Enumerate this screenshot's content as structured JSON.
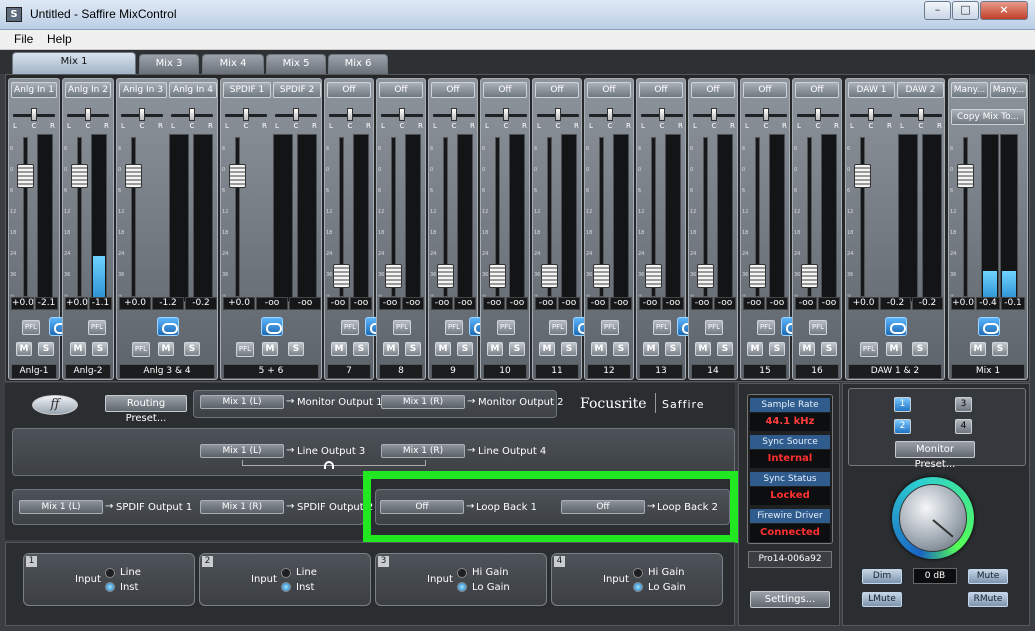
{
  "window": {
    "title": "Untitled - Saffire MixControl",
    "app_icon": "S",
    "minimize_icon": "minimize-icon",
    "maximize_icon": "maximize-icon",
    "close_icon": "close-icon"
  },
  "menu": {
    "file": "File",
    "help": "Help"
  },
  "tabs": [
    {
      "label": "Mix 1",
      "active": true
    },
    {
      "label": "Mix 3"
    },
    {
      "label": "Mix 4"
    },
    {
      "label": "Mix 5"
    },
    {
      "label": "Mix 6"
    }
  ],
  "pan": {
    "left": "L",
    "center": "C",
    "right": "R"
  },
  "buttons": {
    "pfl": "PFL",
    "mute": "M",
    "solo": "S"
  },
  "channels": [
    {
      "sel": [
        "Anlg In 1"
      ],
      "vals": [
        "+0.0",
        "-2.1"
      ],
      "label": "Anlg-1",
      "meters": [
        0
      ]
    },
    {
      "sel": [
        "Anlg In 2"
      ],
      "vals": [
        "+0.0",
        "-1.1"
      ],
      "label": "Anlg-2",
      "meters": [
        0.27
      ]
    },
    {
      "sel": [
        "Anlg In 3",
        "Anlg In 4"
      ],
      "vals": [
        "+0.0",
        "-1.2",
        "-0.2"
      ],
      "label": "Anlg 3 & 4",
      "meters": [
        0
      ]
    },
    {
      "sel": [
        "SPDIF 1",
        "SPDIF 2"
      ],
      "vals": [
        "+0.0",
        "-oo",
        "-oo"
      ],
      "label": "5 + 6",
      "meters": [
        0
      ]
    },
    {
      "sel": [
        "Off"
      ],
      "vals": [
        "-oo",
        "-oo"
      ],
      "label": "7",
      "meters": [
        0
      ]
    },
    {
      "sel": [
        "Off"
      ],
      "vals": [
        "-oo",
        "-oo"
      ],
      "label": "8",
      "meters": [
        0
      ]
    },
    {
      "sel": [
        "Off"
      ],
      "vals": [
        "-oo",
        "-oo"
      ],
      "label": "9",
      "meters": [
        0
      ]
    },
    {
      "sel": [
        "Off"
      ],
      "vals": [
        "-oo",
        "-oo"
      ],
      "label": "10",
      "meters": [
        0
      ]
    },
    {
      "sel": [
        "Off"
      ],
      "vals": [
        "-oo",
        "-oo"
      ],
      "label": "11",
      "meters": [
        0
      ]
    },
    {
      "sel": [
        "Off"
      ],
      "vals": [
        "-oo",
        "-oo"
      ],
      "label": "12",
      "meters": [
        0
      ]
    },
    {
      "sel": [
        "Off"
      ],
      "vals": [
        "-oo",
        "-oo"
      ],
      "label": "13",
      "meters": [
        0
      ]
    },
    {
      "sel": [
        "Off"
      ],
      "vals": [
        "-oo",
        "-oo"
      ],
      "label": "14",
      "meters": [
        0
      ]
    },
    {
      "sel": [
        "Off"
      ],
      "vals": [
        "-oo",
        "-oo"
      ],
      "label": "15",
      "meters": [
        0
      ]
    },
    {
      "sel": [
        "Off"
      ],
      "vals": [
        "-oo",
        "-oo"
      ],
      "label": "16",
      "meters": [
        0
      ]
    },
    {
      "sel": [
        "DAW 1",
        "DAW 2"
      ],
      "vals": [
        "+0.0",
        "-0.2",
        "-0.2"
      ],
      "label": "DAW 1 & 2",
      "meters": [
        0
      ]
    },
    {
      "sel": [
        "Many...",
        "Many..."
      ],
      "copy": "Copy Mix To...",
      "vals": [
        "+0.0",
        "-0.4",
        "-0.1"
      ],
      "label": "Mix 1",
      "meters": [
        0.18,
        0.18
      ]
    }
  ],
  "routing": {
    "logo_icon": "focusrite-ff-logo-icon",
    "preset_button": "Routing Preset...",
    "brand_focusrite": "Focusrite",
    "brand_saffire": "Saffire",
    "rows": [
      {
        "source": "Mix 1 (L)",
        "dest": "Monitor Output 1"
      },
      {
        "source": "Mix 1 (R)",
        "dest": "Monitor Output 2"
      },
      {
        "source": "Mix 1 (L)",
        "dest": "Line Output 3"
      },
      {
        "source": "Mix 1 (R)",
        "dest": "Line Output 4"
      },
      {
        "source": "Mix 1 (L)",
        "dest": "SPDIF Output 1"
      },
      {
        "source": "Mix 1 (R)",
        "dest": "SPDIF Output 2"
      },
      {
        "source": "Off",
        "dest": "Loop Back 1"
      },
      {
        "source": "Off",
        "dest": "Loop Back 2"
      }
    ],
    "arrow": "→",
    "headphone_icon": "headphone-icon"
  },
  "inputs": [
    {
      "num": "1",
      "label": "Input",
      "opt1": "Line",
      "opt2": "Inst",
      "selected": 1
    },
    {
      "num": "2",
      "label": "Input",
      "opt1": "Line",
      "opt2": "Inst",
      "selected": 1
    },
    {
      "num": "3",
      "label": "Input",
      "opt1": "Hi Gain",
      "opt2": "Lo Gain",
      "selected": 1
    },
    {
      "num": "4",
      "label": "Input",
      "opt1": "Hi Gain",
      "opt2": "Lo Gain",
      "selected": 1
    }
  ],
  "status": {
    "sample_rate_label": "Sample Rate",
    "sample_rate": "44.1 kHz",
    "sync_source_label": "Sync Source",
    "sync_source": "Internal",
    "sync_status_label": "Sync Status",
    "sync_status": "Locked",
    "firewire_label": "Firewire Driver",
    "firewire": "Connected",
    "device": "Pro14-006a92",
    "settings_button": "Settings..."
  },
  "monitor": {
    "numbers": [
      "1",
      "3",
      "2",
      "4"
    ],
    "preset_button": "Monitor Preset...",
    "level": "0 dB",
    "dim": "Dim",
    "mute": "Mute",
    "lmute": "LMute",
    "rmute": "RMute",
    "knob_icon": "volume-knob-icon"
  }
}
